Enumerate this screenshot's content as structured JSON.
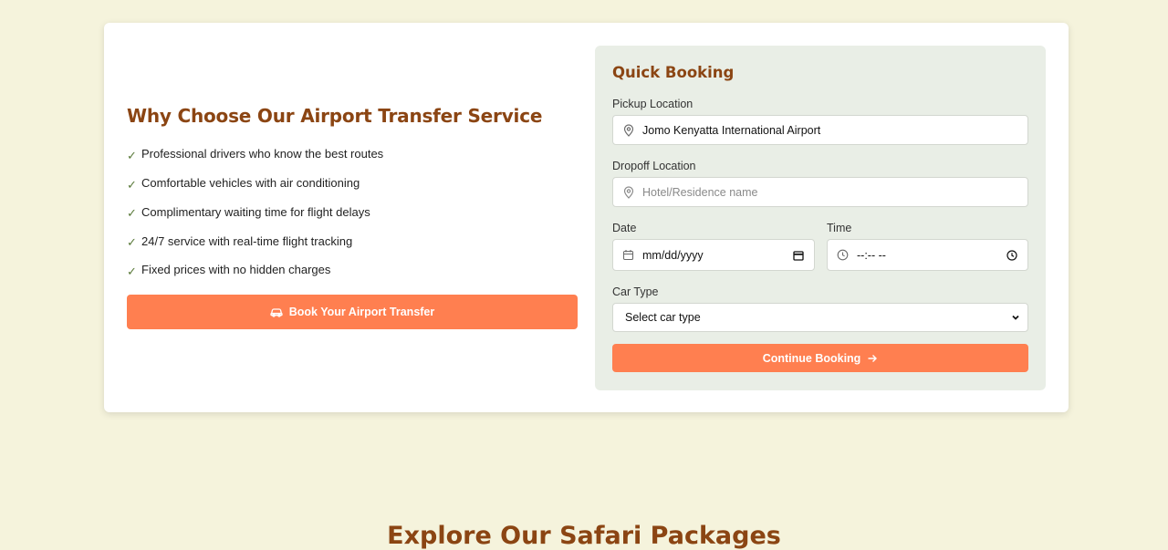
{
  "why": {
    "title": "Why Choose Our Airport Transfer Service",
    "check_glyph": "✓",
    "features": [
      "Professional drivers who know the best routes",
      "Comfortable vehicles with air conditioning",
      "Complimentary waiting time for flight delays",
      "24/7 service with real-time flight tracking",
      "Fixed prices with no hidden charges"
    ],
    "cta_label": "Book Your Airport Transfer"
  },
  "booking": {
    "title": "Quick Booking",
    "pickup": {
      "label": "Pickup Location",
      "value": "Jomo Kenyatta International Airport"
    },
    "dropoff": {
      "label": "Dropoff Location",
      "placeholder": "Hotel/Residence name"
    },
    "date": {
      "label": "Date",
      "placeholder": "mm/dd/yyyy"
    },
    "time": {
      "label": "Time",
      "placeholder": "--:-- --"
    },
    "car_type": {
      "label": "Car Type",
      "selected": "Select car type"
    },
    "continue_label": "Continue Booking"
  },
  "next_section": {
    "title": "Explore Our Safari Packages"
  },
  "colors": {
    "accent": "#ff7f50",
    "heading": "#8b4513",
    "page_bg": "#f5f3dc",
    "form_bg": "#e9eee6"
  },
  "icons": [
    "check-icon",
    "car-icon",
    "map-pin-icon",
    "calendar-icon",
    "clock-icon",
    "chevron-down-icon",
    "arrow-right-icon"
  ]
}
